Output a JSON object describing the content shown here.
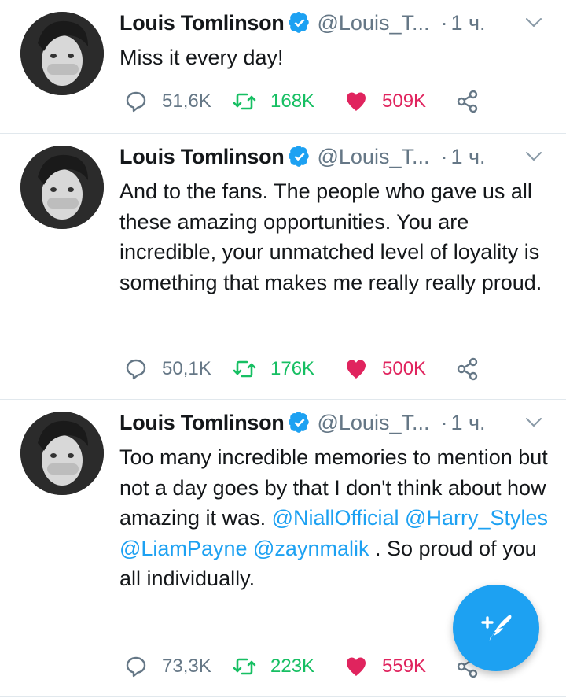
{
  "colors": {
    "accent": "#1da1f2",
    "retweet": "#17bf63",
    "like": "#e0245e",
    "muted": "#657786",
    "text": "#14171a"
  },
  "tweets": [
    {
      "name": "Louis Tomlinson",
      "handle": "@Louis_T...",
      "dot": "·",
      "time": "1 ч.",
      "text": "Miss it every day!",
      "replies": "51,6K",
      "retweets": "168K",
      "likes": "509K"
    },
    {
      "name": "Louis Tomlinson",
      "handle": "@Louis_T...",
      "dot": "·",
      "time": "1 ч.",
      "text": "And to the fans. The people who gave us all these amazing opportunities. You are incredible, your unmatched level of loyality is something that makes me really really proud.",
      "replies": "50,1K",
      "retweets": "176K",
      "likes": "500K"
    },
    {
      "name": "Louis Tomlinson",
      "handle": "@Louis_T...",
      "dot": "·",
      "time": "1 ч.",
      "text_start": "Too many incredible memories to mention but not a day goes by that I don't think about how amazing it was. ",
      "mention_1": "@NiallOfficial",
      "mention_2": "@Harry_Styles",
      "mention_3": "@LiamPayne",
      "mention_4": "@zaynmalik",
      "text_end": " . So proud of you all individually.",
      "replies": "73,3K",
      "retweets": "223K",
      "likes": "559K"
    }
  ],
  "icons": {
    "verified": "verified-badge-icon",
    "chevron": "chevron-down-icon",
    "reply": "reply-icon",
    "retweet": "retweet-icon",
    "like": "heart-icon",
    "share": "share-icon",
    "compose": "compose-tweet-icon"
  }
}
